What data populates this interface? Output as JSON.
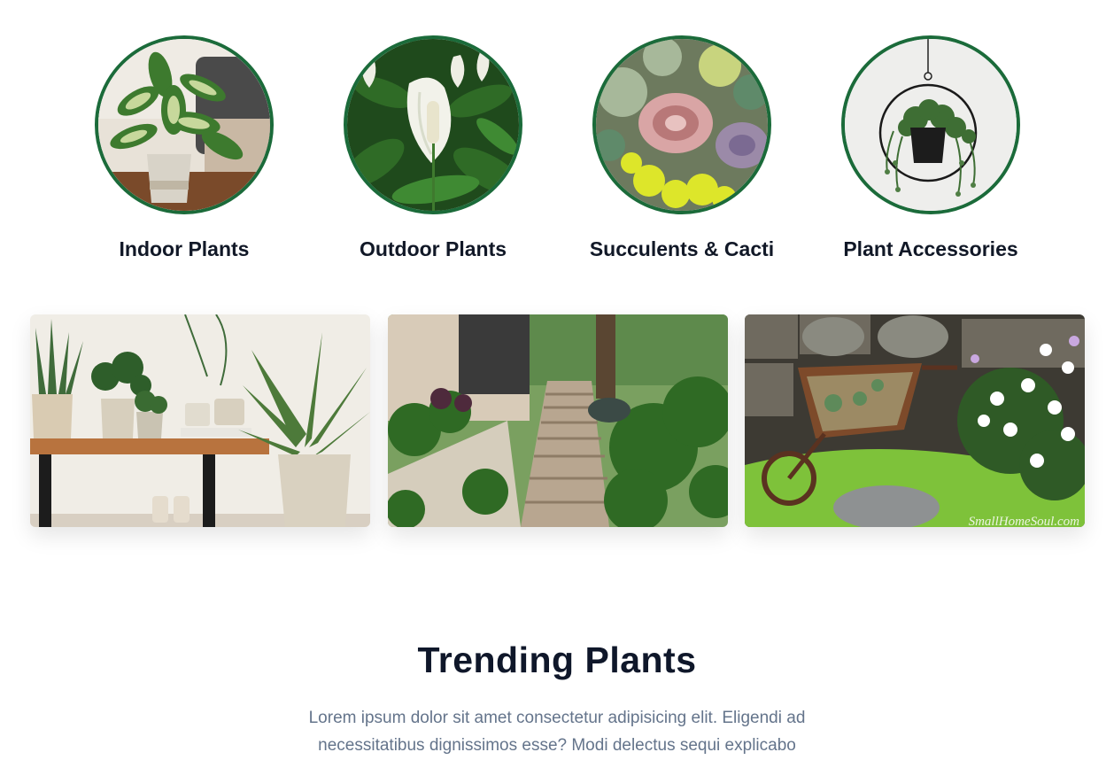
{
  "categories": [
    {
      "label": "Indoor Plants",
      "image": "dieffenbachia-potted-plant"
    },
    {
      "label": "Outdoor Plants",
      "image": "peace-lily-flowers"
    },
    {
      "label": "Succulents & Cacti",
      "image": "succulent-arrangement"
    },
    {
      "label": "Plant Accessories",
      "image": "hanging-planter-ring"
    }
  ],
  "gallery": [
    {
      "image": "indoor-plants-on-bench"
    },
    {
      "image": "garden-steps-with-plants"
    },
    {
      "image": "wheelbarrow-planter-with-daisies",
      "watermark": "SmallHomeSoul.com"
    }
  ],
  "trending": {
    "title": "Trending Plants",
    "description": "Lorem ipsum dolor sit amet consectetur adipisicing elit. Eligendi ad necessitatibus dignissimos esse? Modi delectus sequi explicabo"
  },
  "colors": {
    "accent": "#1b6b3a",
    "heading": "#0f172a",
    "body_text": "#64748b"
  }
}
